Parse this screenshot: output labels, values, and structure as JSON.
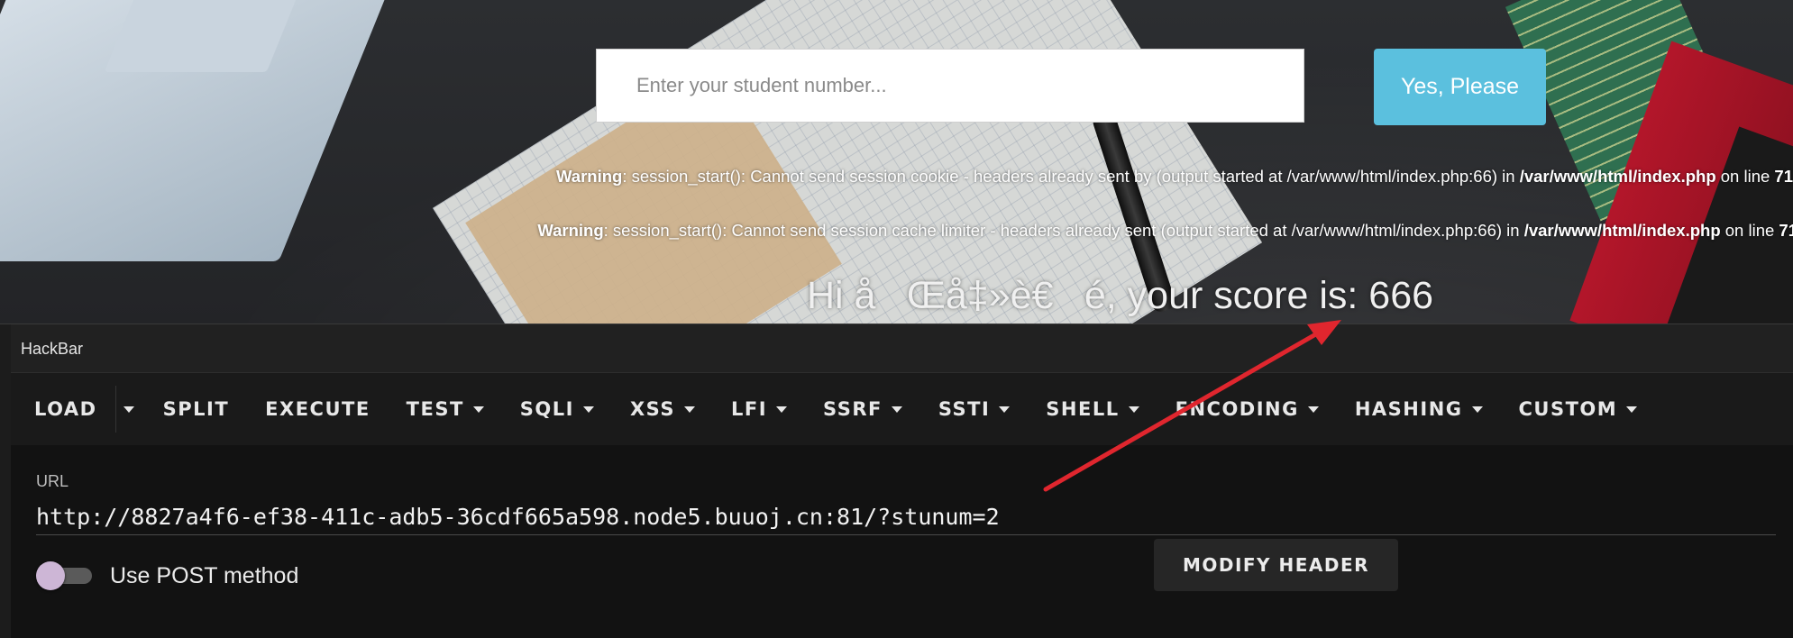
{
  "page": {
    "student_input": {
      "placeholder": "Enter your student number...",
      "value": ""
    },
    "submit_label": "Yes, Please",
    "warnings": [
      {
        "prefix": "Warning",
        "message": ": session_start(): Cannot send session cookie - headers already sent by (output started at /var/www/html/index.php:66) in ",
        "file": "/var/www/html/index.php",
        "suffix": " on line ",
        "line": "71"
      },
      {
        "prefix": "Warning",
        "message": ": session_start(): Cannot send session cache limiter - headers already sent (output started at /var/www/html/index.php:66) in ",
        "file": "/var/www/html/index.php",
        "suffix": " on line ",
        "line": "71"
      }
    ],
    "score_text": "Hi åŒå‡»è€é, your score is: 666"
  },
  "hackbar": {
    "title": "HackBar",
    "toolbar": {
      "load": "LOAD",
      "split": "SPLIT",
      "execute": "EXECUTE",
      "test": "TEST",
      "sqli": "SQLI",
      "xss": "XSS",
      "lfi": "LFI",
      "ssrf": "SSRF",
      "ssti": "SSTI",
      "shell": "SHELL",
      "encoding": "ENCODING",
      "hashing": "HASHING",
      "custom": "CUSTOM"
    },
    "url_label": "URL",
    "url_value": "http://8827a4f6-ef38-411c-adb5-36cdf665a598.node5.buuoj.cn:81/?stunum=2",
    "post_label": "Use POST method",
    "post_enabled": false,
    "modify_header_label": "MODIFY HEADER"
  },
  "annotation": {
    "arrow_color": "#e0262e"
  },
  "colors": {
    "accent_button": "#5bc0de",
    "toggle_thumb": "#cdb6d6"
  }
}
